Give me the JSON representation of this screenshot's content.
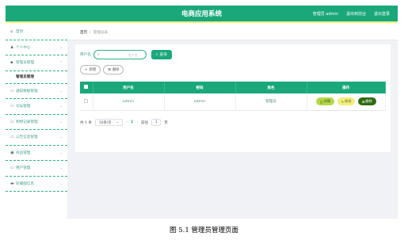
{
  "header": {
    "title": "电商应用系统",
    "nav": [
      "管理员 admin",
      "退出到前台",
      "退出登录"
    ]
  },
  "sidebar": {
    "items": [
      {
        "label": "首页",
        "icon": "home-icon",
        "chevron": false
      },
      {
        "label": "个人中心",
        "icon": "user-icon",
        "chevron": true
      },
      {
        "label": "管理员管理",
        "icon": "admin-icon",
        "chevron": true
      },
      {
        "label": "通知数据管理",
        "icon": "notice-icon",
        "chevron": true
      },
      {
        "label": "论坛管理",
        "icon": "forum-icon",
        "chevron": true
      },
      {
        "label": "购物记录管理",
        "icon": "record-icon",
        "chevron": true
      },
      {
        "label": "公告信息管理",
        "icon": "announcement-icon",
        "chevron": true
      },
      {
        "label": "商品管理",
        "icon": "goods-icon",
        "chevron": true
      },
      {
        "label": "用户管理",
        "icon": "users-icon",
        "chevron": true
      },
      {
        "label": "轮播图信息",
        "icon": "carousel-icon",
        "chevron": true
      }
    ],
    "sub_item": "管理员管理"
  },
  "breadcrumb": {
    "home": "首页",
    "separator": "/",
    "current": "管理员表"
  },
  "search": {
    "label": "用户名",
    "placeholder": "用户名",
    "button": "查询"
  },
  "actions": {
    "add": "新增",
    "delete": "删除"
  },
  "table": {
    "headers": [
      "用户名",
      "密码",
      "角色",
      "操作"
    ],
    "rows": [
      {
        "username": "admin",
        "password": "admin",
        "role": "管理员",
        "ops": [
          "详情",
          "修改",
          "删除"
        ]
      }
    ]
  },
  "pagination": {
    "total": "共 1 条",
    "page_size": "10条/页",
    "current_page": "1",
    "goto_label": "前往",
    "goto_value": "1",
    "page_suffix": "页"
  },
  "caption": "图 5.1  管理员管理页面",
  "colors": {
    "primary": "#1aa87a",
    "accent_yellow": "#f1ef7a",
    "detail": "#b6d84a",
    "danger": "#2f6b0f"
  }
}
